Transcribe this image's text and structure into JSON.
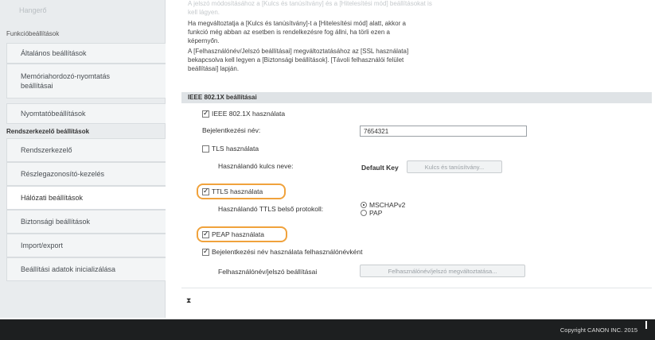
{
  "sidebar": {
    "top_item": "Hangerő",
    "heading1": "Funkcióbeállítások",
    "items_group1": [
      {
        "label": "Általános beállítások"
      },
      {
        "label": "Memóriahordozó-nyomtatás beállításai"
      },
      {
        "label": "Nyomtatóbeállítások"
      }
    ],
    "heading2": "Rendszerkezelő beállítások",
    "items_group2": [
      {
        "label": "Rendszerkezelő"
      },
      {
        "label": "Részlegazonosító-kezelés"
      },
      {
        "label": "Hálózati beállítások"
      },
      {
        "label": "Biztonsági beállítások"
      },
      {
        "label": "Import/export"
      },
      {
        "label": "Beállítási adatok inicializálása"
      }
    ]
  },
  "main": {
    "notes": [
      "A jelszó módosításához a [Kulcs és tanúsítvány] és a [Hitelesítési mód] beállításokat is",
      "kell lágyen.",
      "Ha megváltoztatja a [Kulcs és tanúsítvány]-t a [Hitelesítési mód] alatt, akkor a",
      "funkció még abban az esetben is rendelkezésre fog állni, ha törli ezen a",
      "képernyőn.",
      "A [Felhasználónév/Jelszó beállításai] megváltoztatásához az [SSL használata]",
      "bekapcsolva kell legyen a [Biztonsági beállítások]. [Távoli felhasználói felület",
      "beállításai] lapján."
    ],
    "section_title": "IEEE 802.1X beállításai",
    "ieee_use_label": "IEEE 802.1X használata",
    "login_name_label": "Bejelentkezési név:",
    "login_name_value": "7654321",
    "tls_label": "TLS használata",
    "key_name_label": "Használandó kulcs neve:",
    "key_name_value": "Default Key",
    "key_button": "Kulcs és tanúsítvány...",
    "ttls_label": "TTLS használata",
    "ttls_protocol_label": "Használandó TTLS belső protokoll:",
    "ttls_options": [
      "MSCHAPv2",
      "PAP"
    ],
    "peap_label": "PEAP használata",
    "use_login_name_label": "Bejelentkezési név használata felhasználónévként",
    "user_pwd_settings_label": "Felhasználónév/jelszó beállításai",
    "user_pwd_button": "Felhasználónév/jelszó megváltoztatása...",
    "top_icon": "⧗"
  },
  "footer": {
    "copyright": "Copyright CANON INC. 2015"
  }
}
